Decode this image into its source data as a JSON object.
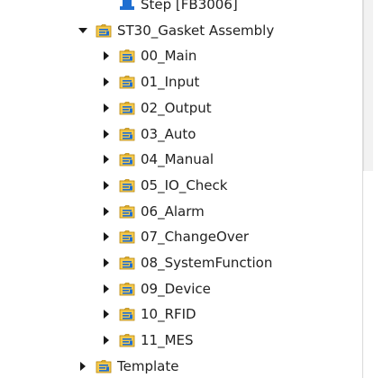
{
  "tree": {
    "items": [
      {
        "label": "Step [FB3006]",
        "icon": "function-block-icon",
        "arrow": "none",
        "level": 4
      },
      {
        "label": "ST30_Gasket Assembly",
        "icon": "program-folder-icon",
        "arrow": "expanded",
        "level": 3
      },
      {
        "label": "00_Main",
        "icon": "program-folder-icon",
        "arrow": "collapsed",
        "level": 4
      },
      {
        "label": "01_Input",
        "icon": "program-folder-icon",
        "arrow": "collapsed",
        "level": 4
      },
      {
        "label": "02_Output",
        "icon": "program-folder-icon",
        "arrow": "collapsed",
        "level": 4
      },
      {
        "label": "03_Auto",
        "icon": "program-folder-icon",
        "arrow": "collapsed",
        "level": 4
      },
      {
        "label": "04_Manual",
        "icon": "program-folder-icon",
        "arrow": "collapsed",
        "level": 4
      },
      {
        "label": "05_IO_Check",
        "icon": "program-folder-icon",
        "arrow": "collapsed",
        "level": 4
      },
      {
        "label": "06_Alarm",
        "icon": "program-folder-icon",
        "arrow": "collapsed",
        "level": 4
      },
      {
        "label": "07_ChangeOver",
        "icon": "program-folder-icon",
        "arrow": "collapsed",
        "level": 4
      },
      {
        "label": "08_SystemFunction",
        "icon": "program-folder-icon",
        "arrow": "collapsed",
        "level": 4
      },
      {
        "label": "09_Device",
        "icon": "program-folder-icon",
        "arrow": "collapsed",
        "level": 4
      },
      {
        "label": "10_RFID",
        "icon": "program-folder-icon",
        "arrow": "collapsed",
        "level": 4
      },
      {
        "label": "11_MES",
        "icon": "program-folder-icon",
        "arrow": "collapsed",
        "level": 4
      },
      {
        "label": "Template",
        "icon": "program-folder-icon",
        "arrow": "collapsed",
        "level": 3
      }
    ]
  },
  "colors": {
    "folder_fill": "#f5c94c",
    "folder_border": "#b8860b",
    "block_blue": "#1f6fd1",
    "text": "#222222"
  }
}
